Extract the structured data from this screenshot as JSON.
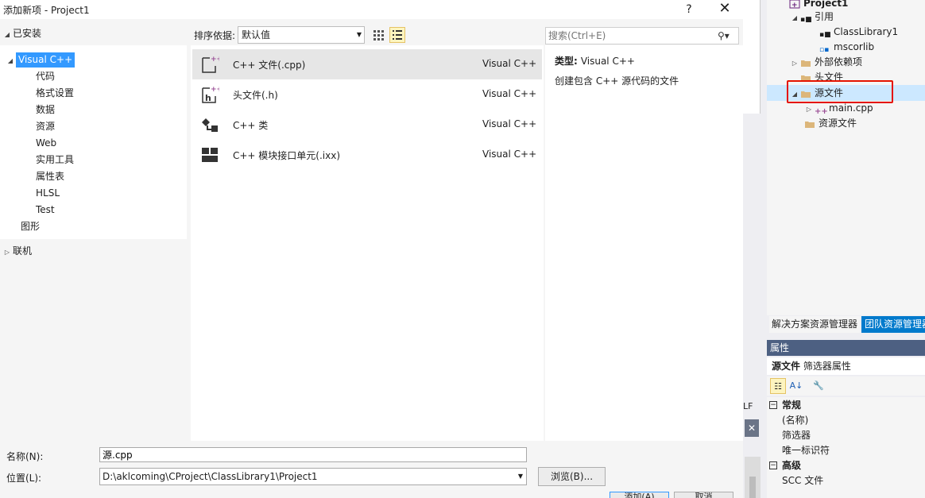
{
  "dialog": {
    "title": "添加新项 - Project1",
    "help": "?",
    "close": "✕"
  },
  "left_tree": {
    "installed": "已安装",
    "visual_cpp": "Visual C++",
    "children": [
      "代码",
      "格式设置",
      "数据",
      "资源",
      "Web",
      "实用工具",
      "属性表",
      "HLSL",
      "Test"
    ],
    "graphics": "图形",
    "online": "联机"
  },
  "sort": {
    "label": "排序依据:",
    "value": "默认值"
  },
  "items": [
    {
      "name": "C++ 文件(.cpp)",
      "lang": "Visual C++",
      "icon": "cpp-file-icon"
    },
    {
      "name": "头文件(.h)",
      "lang": "Visual C++",
      "icon": "header-file-icon"
    },
    {
      "name": "C++ 类",
      "lang": "Visual C++",
      "icon": "class-icon"
    },
    {
      "name": "C++ 模块接口单元(.ixx)",
      "lang": "Visual C++",
      "icon": "module-icon"
    }
  ],
  "search": {
    "placeholder": "搜索(Ctrl+E)"
  },
  "details": {
    "type_label": "类型:",
    "type_value": "Visual C++",
    "description": "创建包含 C++ 源代码的文件"
  },
  "fields": {
    "name_label": "名称(N):",
    "name_value": "源.cpp",
    "location_label": "位置(L):",
    "location_value": "D:\\aklcoming\\CProject\\ClassLibrary1\\Project1",
    "browse": "浏览(B)...",
    "add": "添加(A)",
    "cancel": "取消"
  },
  "ide": {
    "lf": "LF",
    "close_x": "✕"
  },
  "solution_explorer": {
    "project": "Project1",
    "references": "引用",
    "ref_items": [
      "ClassLibrary1",
      "mscorlib"
    ],
    "external": "外部依赖项",
    "headers": "头文件",
    "sources": "源文件",
    "main_cpp": "main.cpp",
    "resources": "资源文件",
    "tab_solution": "解决方案资源管理器",
    "tab_team": "团队资源管理器"
  },
  "properties": {
    "header": "属性",
    "object_name": "源文件",
    "object_type": "筛选器属性",
    "cat_general": "常规",
    "rows_general": [
      "(名称)",
      "筛选器",
      "唯一标识符"
    ],
    "cat_advanced": "高级",
    "rows_advanced": [
      "SCC 文件"
    ]
  },
  "colors": {
    "selection_blue": "#3399ff",
    "highlight_red": "#e51400",
    "team_tab": "#007acc",
    "prop_header": "#4d6082"
  }
}
